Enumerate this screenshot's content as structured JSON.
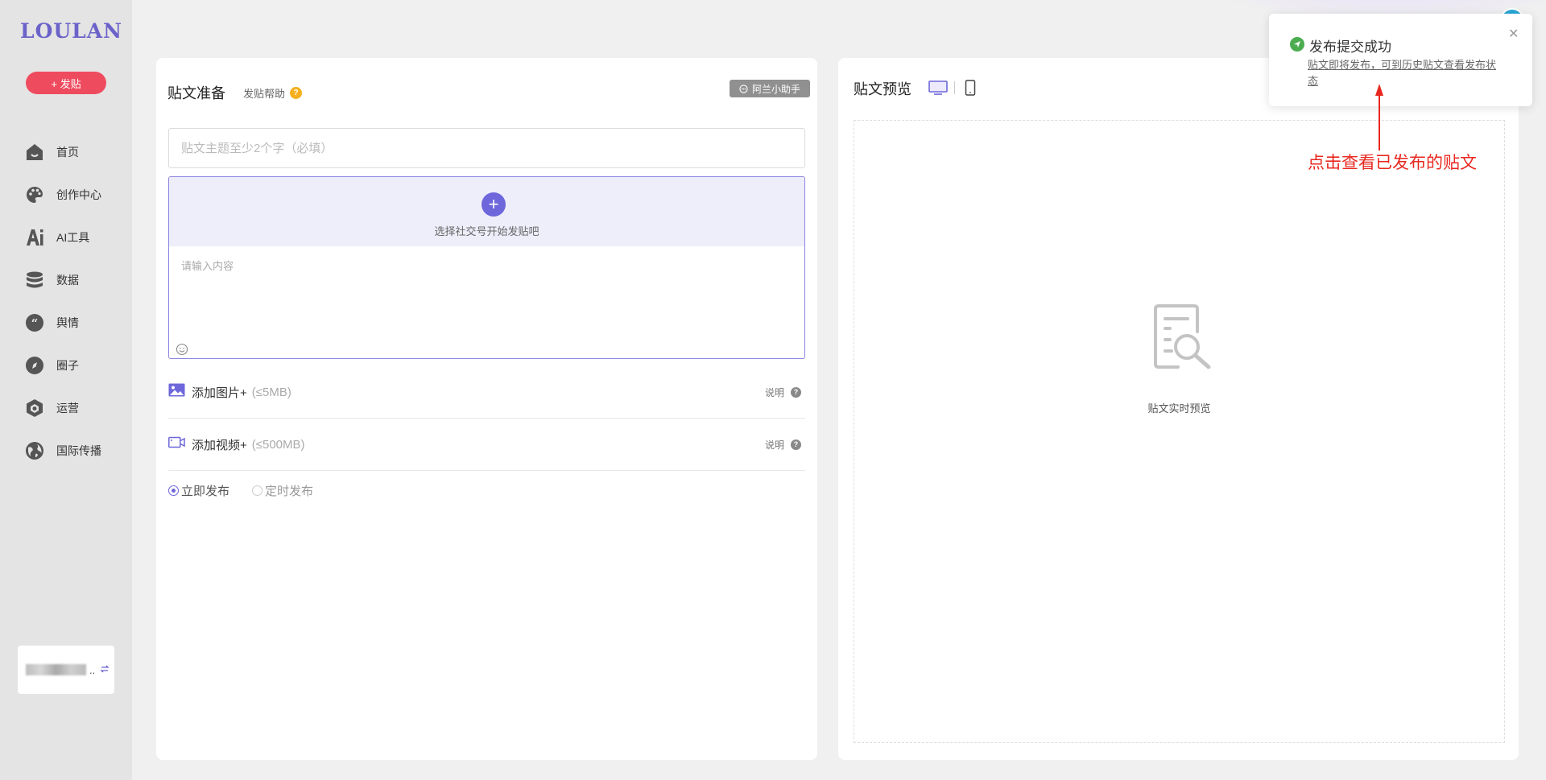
{
  "brand": {
    "logo": "LOULAN"
  },
  "sidebar": {
    "post_button": "+ 发贴",
    "items": [
      {
        "label": "首页",
        "icon": "home-icon"
      },
      {
        "label": "创作中心",
        "icon": "palette-icon"
      },
      {
        "label": "AI工具",
        "icon": "ai-icon"
      },
      {
        "label": "数据",
        "icon": "database-icon"
      },
      {
        "label": "舆情",
        "icon": "quote-icon"
      },
      {
        "label": "圈子",
        "icon": "compass-icon"
      },
      {
        "label": "运营",
        "icon": "hexagon-icon"
      },
      {
        "label": "国际传播",
        "icon": "globe-icon"
      }
    ],
    "account": {
      "name_suffix": "..",
      "switch_icon": "switch-icon"
    }
  },
  "editor": {
    "title": "贴文准备",
    "help_link": "发贴帮助",
    "assistant_button": "阿兰小助手",
    "title_placeholder": "贴文主题至少2个字（必填）",
    "select_account_hint": "选择社交号开始发贴吧",
    "content_placeholder": "请输入内容",
    "image_row": {
      "label": "添加图片+",
      "size_limit": "(≤5MB)",
      "help": "说明"
    },
    "video_row": {
      "label": "添加视频+",
      "size_limit": "(≤500MB)",
      "help": "说明"
    },
    "publish_options": [
      {
        "label": "立即发布",
        "selected": true
      },
      {
        "label": "定时发布",
        "selected": false
      }
    ]
  },
  "preview": {
    "title": "贴文预览",
    "devices": [
      "desktop-icon",
      "mobile-icon"
    ],
    "empty_text": "贴文实时预览"
  },
  "toast": {
    "title": "发布提交成功",
    "message": "贴文即将发布，可到历史贴文查看发布状态"
  },
  "annotation": {
    "text": "点击查看已发布的贴文",
    "color": "#e8281f"
  },
  "colors": {
    "accent": "#6d67db",
    "post_button": "#ef4b5f",
    "success": "#4cad50",
    "help_badge": "#f5b020"
  }
}
